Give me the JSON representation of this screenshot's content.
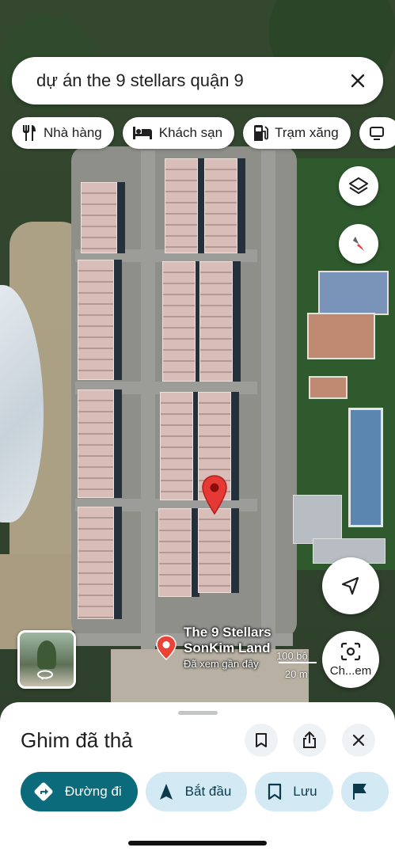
{
  "search": {
    "query": "dự án the 9 stellars quận 9"
  },
  "chips": [
    {
      "label": "Nhà hàng",
      "icon": "restaurant-icon"
    },
    {
      "label": "Khách sạn",
      "icon": "hotel-icon"
    },
    {
      "label": "Trạm xăng",
      "icon": "gas-station-icon"
    }
  ],
  "map": {
    "place_name": "The 9 Stellars",
    "place_sub": "SonKim Land",
    "place_note": "Đã xem gần đây",
    "scale_ft": "100 bộ",
    "scale_m": "20 m",
    "camera_label": "Ch...em"
  },
  "sheet": {
    "title": "Ghim đã thả",
    "actions": [
      {
        "label": "Đường đi",
        "icon": "directions-icon"
      },
      {
        "label": "Bắt đầu",
        "icon": "navigation-icon"
      },
      {
        "label": "Lưu",
        "icon": "bookmark-icon"
      }
    ]
  },
  "colors": {
    "accent": "#0b6b7a",
    "chip_bg": "#d3eaf5",
    "pin": "#e53935"
  }
}
